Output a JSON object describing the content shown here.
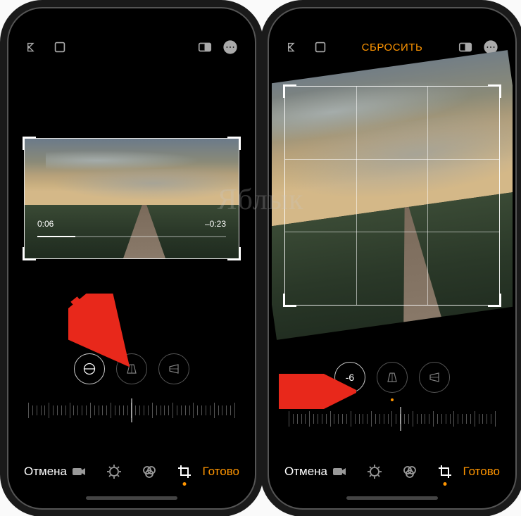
{
  "watermark": "Яблык",
  "left": {
    "video": {
      "elapsed": "0:06",
      "remaining": "–0:23",
      "progress_pct": 20
    },
    "adjust": {
      "buttons": [
        {
          "name": "straighten",
          "icon": "level",
          "active": true
        },
        {
          "name": "vertical-perspective",
          "icon": "v-persp",
          "active": false
        },
        {
          "name": "horizontal-perspective",
          "icon": "h-persp",
          "active": false
        }
      ]
    },
    "bottom": {
      "cancel": "Отмена",
      "done": "Готово"
    }
  },
  "right": {
    "reset_label": "СБРОСИТЬ",
    "adjust": {
      "value": "-6",
      "buttons": [
        {
          "name": "straighten-value",
          "label": "-6",
          "active": true
        },
        {
          "name": "vertical-perspective",
          "icon": "v-persp",
          "active": false
        },
        {
          "name": "horizontal-perspective",
          "icon": "h-persp",
          "active": false
        }
      ]
    },
    "bottom": {
      "cancel": "Отмена",
      "done": "Готово"
    }
  },
  "tabs": [
    "video",
    "adjust",
    "filters",
    "crop"
  ],
  "active_tab": "crop"
}
